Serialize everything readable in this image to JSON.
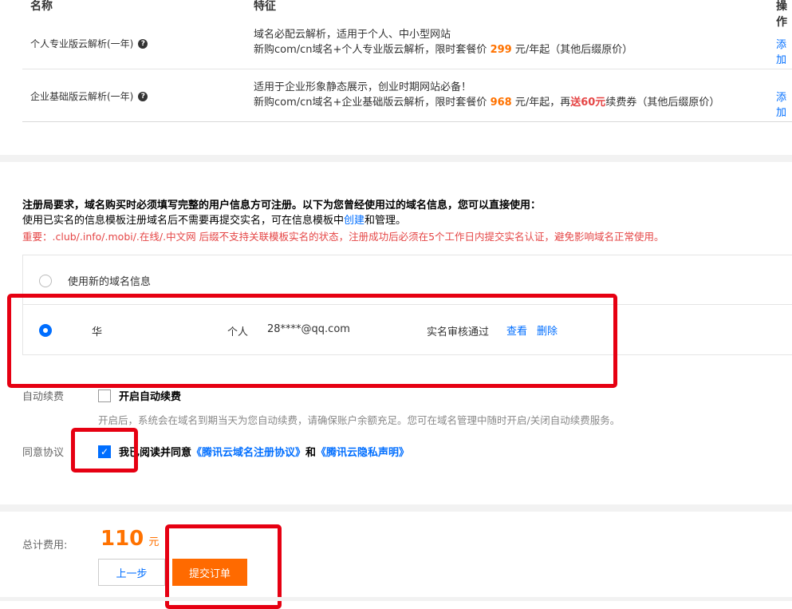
{
  "table": {
    "headers": [
      "名称",
      "特征",
      "操作"
    ],
    "rows": [
      {
        "name": "个人专业版云解析(一年)",
        "feature_line1": "域名必配云解析，适用于个人、中小型网站",
        "feature_line2_pre": "新购com/cn域名+个人专业版云解析，限时套餐价 ",
        "price": "299",
        "feature_line2_post": " 元/年起（其他后缀原价）",
        "action": "添加"
      },
      {
        "name": "企业基础版云解析(一年)",
        "feature_line1": "适用于企业形象静态展示，创业时期网站必备！",
        "feature_line2_pre": "新购com/cn域名+企业基础版云解析，限时套餐价 ",
        "price": "968",
        "feature_line2_mid": " 元/年起，再",
        "coupon": "送60元",
        "feature_line2_post": "续费券（其他后缀原价）",
        "action": "添加"
      }
    ]
  },
  "notice": {
    "title": "注册局要求，域名购买时必须填写完整的用户信息方可注册。以下为您曾经使用过的域名信息，您可以直接使用：",
    "line2_pre": "使用已实名的信息模板注册域名后不需要再提交实名，可在信息模板中",
    "line2_link": "创建",
    "line2_post": "和管理。",
    "important": "重要：.club/.info/.mobi/.在线/.中文网 后缀不支持关联模板实名的状态，注册成功后必须在5个工作日内提交实名认证，避免影响域名正常使用。"
  },
  "info_options": {
    "new_label": "使用新的域名信息",
    "selected": {
      "name": "华",
      "type": "个人",
      "email": "28****@qq.com",
      "status": "实名审核通过",
      "view": "查看",
      "delete": "删除"
    }
  },
  "auto_renew": {
    "label": "自动续费",
    "checkbox_label": "开启自动续费",
    "hint": "开启后，系统会在域名到期当天为您自动续费，请确保账户余额充足。您可在域名管理中随时开启/关闭自动续费服务。"
  },
  "agreement": {
    "label": "同意协议",
    "text_pre": "我已阅读并同意",
    "link1": "《腾讯云域名注册协议》",
    "and": "和",
    "link2": "《腾讯云隐私声明》",
    "checked": true
  },
  "total": {
    "label": "总计费用:",
    "amount": "110",
    "unit": "元"
  },
  "buttons": {
    "prev": "上一步",
    "submit": "提交订单"
  },
  "colors": {
    "accent": "#006eff",
    "price": "#ff7200",
    "warning": "#e54545",
    "annotation": "#e60012",
    "submit": "#ff6a00"
  }
}
